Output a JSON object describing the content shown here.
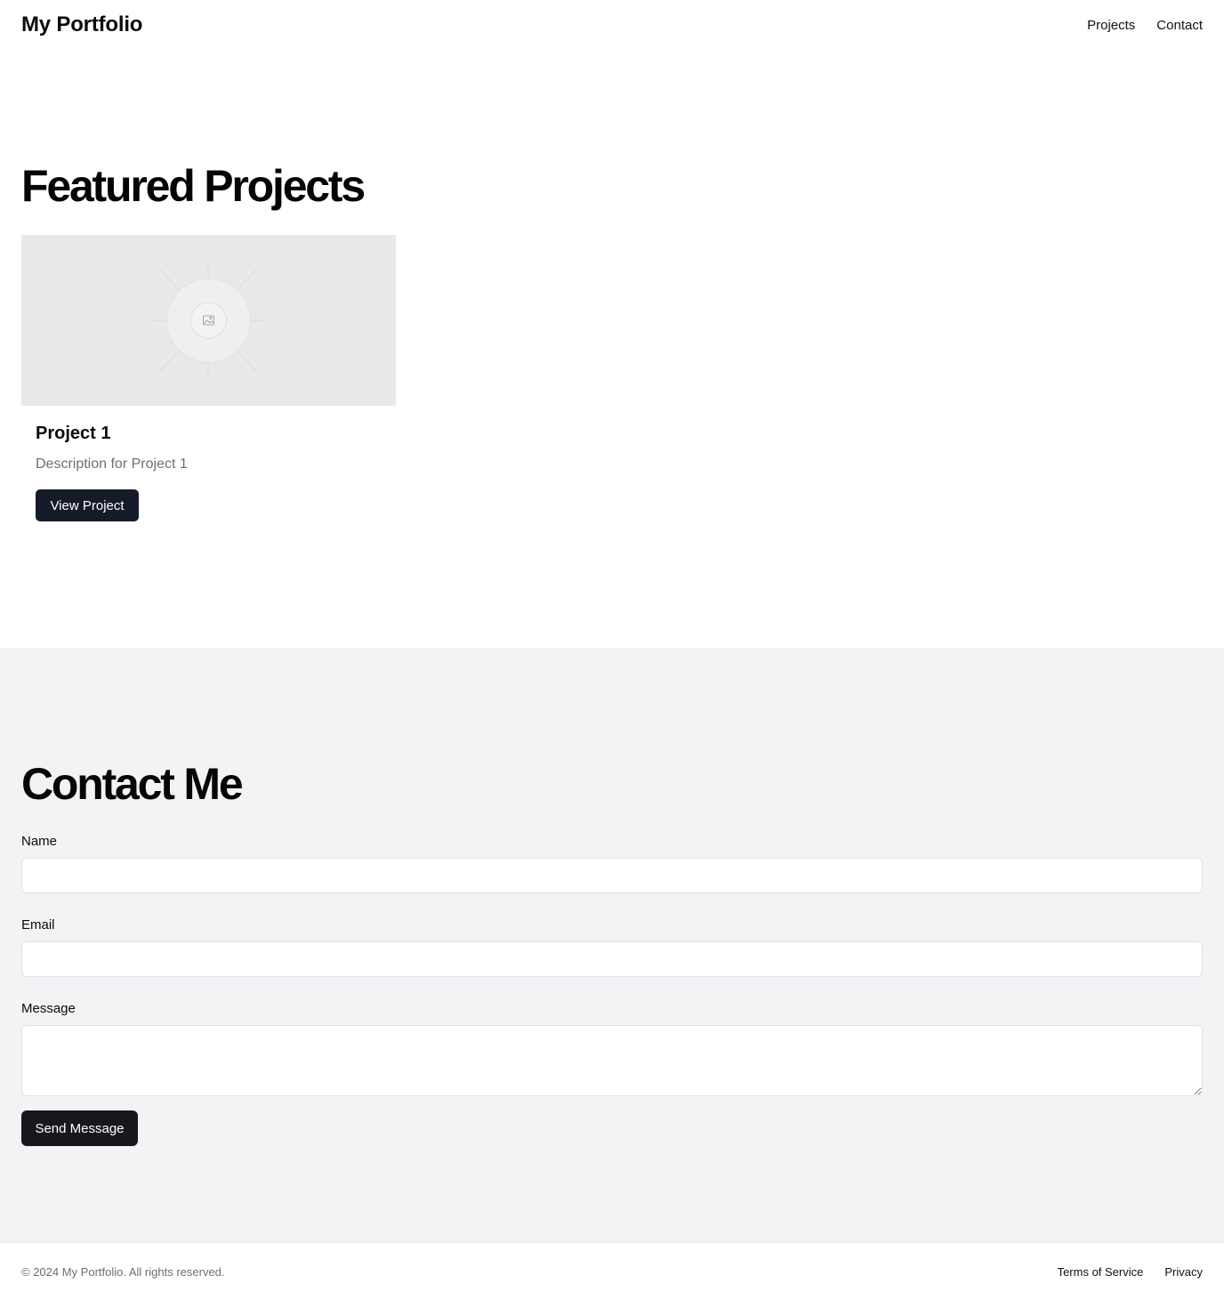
{
  "header": {
    "brand": "My Portfolio",
    "nav": [
      {
        "label": "Projects"
      },
      {
        "label": "Contact"
      }
    ]
  },
  "projects": {
    "title": "Featured Projects",
    "items": [
      {
        "image_icon": "image-placeholder-icon",
        "title": "Project 1",
        "description": "Description for Project 1",
        "button_label": "View Project"
      }
    ]
  },
  "contact": {
    "title": "Contact Me",
    "fields": {
      "name_label": "Name",
      "name_value": "",
      "email_label": "Email",
      "email_value": "",
      "message_label": "Message",
      "message_value": ""
    },
    "submit_label": "Send Message"
  },
  "footer": {
    "copyright": "© 2024 My Portfolio. All rights reserved.",
    "links": [
      {
        "label": "Terms of Service"
      },
      {
        "label": "Privacy"
      }
    ]
  },
  "colors": {
    "button_primary": "#161b2a",
    "button_submit": "#17181c",
    "contact_background": "#f2f3f5",
    "placeholder_background": "#e9e9e9",
    "muted_text": "#6b6f76"
  }
}
